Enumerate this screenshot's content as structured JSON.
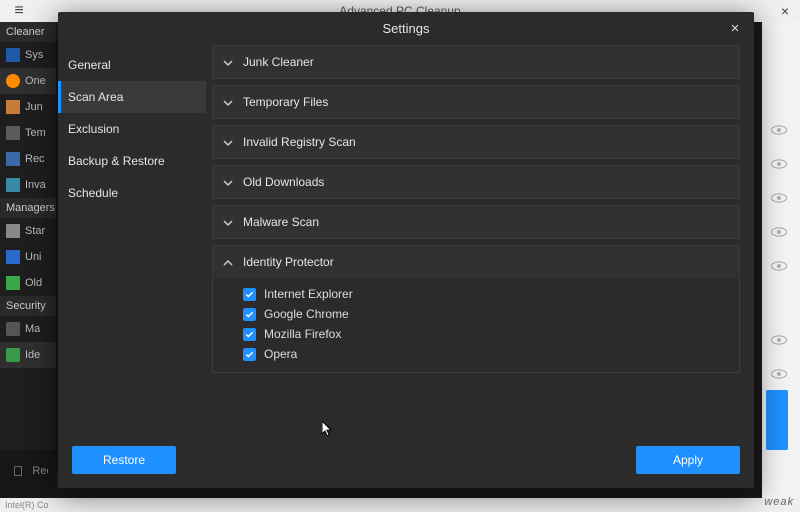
{
  "bg": {
    "title": "Advanced PC Cleanup",
    "menu_glyph": "≡",
    "close_glyph": "×",
    "left": {
      "cleaner_hdr": "Cleaner",
      "items": [
        "Sys",
        "One",
        "Jun",
        "Tem",
        "Rec",
        "Inva"
      ],
      "managers_hdr": "Managers",
      "m_items": [
        "Star",
        "Uni",
        "Old"
      ],
      "security_hdr": "Security",
      "s_items": [
        "Ma",
        "Ide"
      ],
      "rec_label": "Rec"
    },
    "status": "Intel(R) Co",
    "watermark": "weak"
  },
  "modal": {
    "title": "Settings",
    "close": "×",
    "side": {
      "items": [
        {
          "label": "General"
        },
        {
          "label": "Scan Area"
        },
        {
          "label": "Exclusion"
        },
        {
          "label": "Backup & Restore"
        },
        {
          "label": "Schedule"
        }
      ],
      "selected_index": 1
    },
    "sections": [
      {
        "label": "Junk Cleaner",
        "expanded": false
      },
      {
        "label": "Temporary Files",
        "expanded": false
      },
      {
        "label": "Invalid Registry Scan",
        "expanded": false
      },
      {
        "label": "Old Downloads",
        "expanded": false
      },
      {
        "label": "Malware Scan",
        "expanded": false
      },
      {
        "label": "Identity Protector",
        "expanded": true,
        "options": [
          {
            "label": "Internet Explorer",
            "checked": true
          },
          {
            "label": "Google Chrome",
            "checked": true
          },
          {
            "label": "Mozilla Firefox",
            "checked": true
          },
          {
            "label": "Opera",
            "checked": true
          }
        ]
      }
    ],
    "buttons": {
      "restore": "Restore",
      "apply": "Apply"
    }
  },
  "colors": {
    "accent": "#1e90ff"
  }
}
